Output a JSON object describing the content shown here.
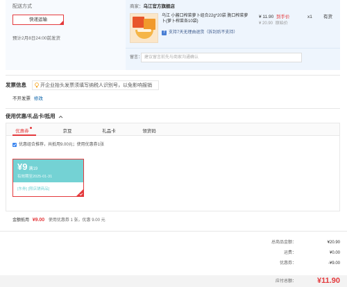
{
  "delivery": {
    "label": "配送方式",
    "selected_option": "快递运输",
    "estimate": "预计2月8日24:00前发货"
  },
  "shop": {
    "label": "商家：",
    "name": "乌江官方旗舰店"
  },
  "product": {
    "title": "乌江 小酱口榨菜萝卜组合22g*20袋 脆口榨菜萝卜(萝卜榨菜各10袋)",
    "price": "¥ 11.90",
    "price_tag": "到手价",
    "original_price": "¥ 20.90",
    "original_tag": "原始价",
    "quantity": "x1",
    "stock": "有货",
    "return_badge": "7",
    "return_policy": "支持7天无理由退货（拆封后不支持）"
  },
  "message": {
    "label": "留言：",
    "placeholder": "建议留言前先与商家沟通确认"
  },
  "invoice": {
    "title": "发票信息",
    "tip": "开企业抬头发票须填写纳税人识别号，以免影响报销",
    "value": "不开发票",
    "edit_link": "修改"
  },
  "discount": {
    "title": "使用优惠/礼品卡/抵用",
    "tabs": [
      {
        "label": "优惠券",
        "active": true
      },
      {
        "label": "京豆",
        "active": false
      },
      {
        "label": "礼品卡",
        "active": false
      },
      {
        "label": "领货码",
        "active": false
      }
    ],
    "recommend_checked": true,
    "recommend_text": "优惠组合推荐，共抵用9.00元；使用优惠券1张",
    "coupon": {
      "amount": "¥9",
      "condition": "满19",
      "validity": "有效期至2025-01-31",
      "tags": "[东券] [限店铺商品]",
      "selected": true
    },
    "applied_label": "金额抵用",
    "applied_amount": "¥9.00",
    "applied_detail": "使用优惠券 1 张，优惠 9.00 元"
  },
  "totals": {
    "items": [
      {
        "label": "总商品金额：",
        "value": "¥20.90"
      },
      {
        "label": "运费：",
        "value": "¥0.00"
      },
      {
        "label": "优惠券：",
        "value": "-¥9.00"
      }
    ],
    "payable_label": "应付总额：",
    "payable_value": "¥11.90"
  },
  "icons": {
    "delivery_selected": "selected-corner-icon",
    "return_policy": "return-7day-icon",
    "invoice_tip": "lightbulb-icon",
    "discount_toggle": "chevron-up-icon",
    "recommend": "checkbox-checked-icon",
    "coupon_selected": "selected-check-icon"
  },
  "colors": {
    "accent_red": "#e4393c",
    "link_blue": "#005ea7",
    "coupon_teal": "#74d2d4",
    "checkbox_blue": "#3b86f0",
    "return_badge_blue": "#4a7fd4",
    "shipping_bg": "#eef5fd",
    "shipping_bg_left": "#f7fafe"
  }
}
